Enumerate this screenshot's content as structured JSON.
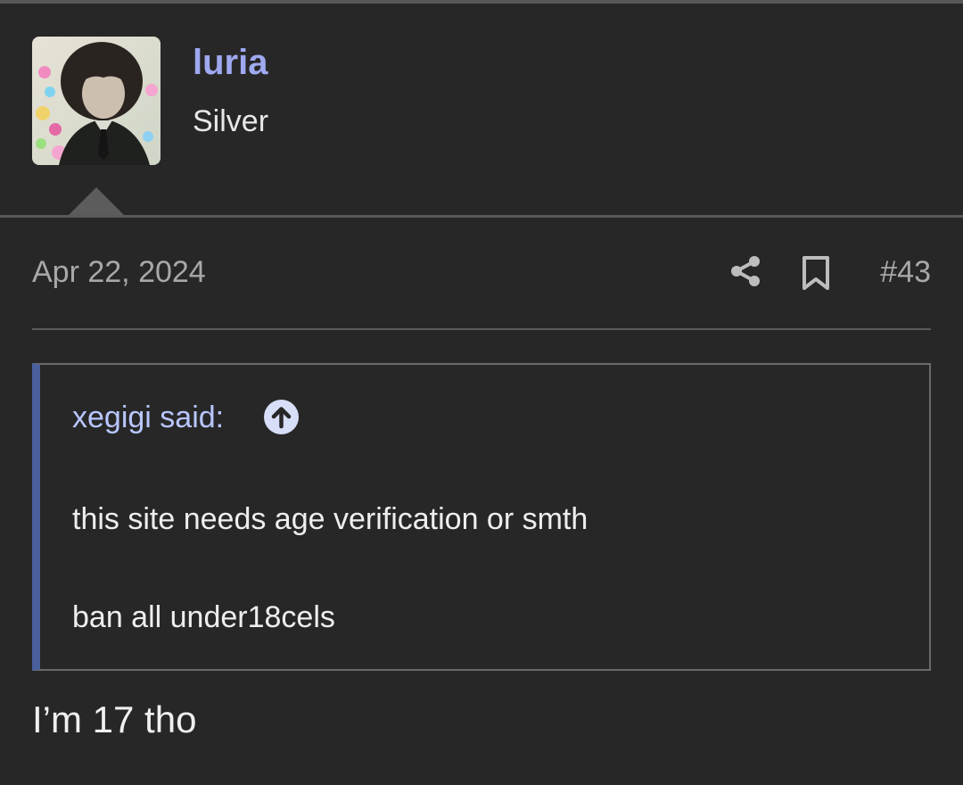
{
  "user": {
    "name": "luria",
    "title": "Silver",
    "avatar_icon": "avatar-image"
  },
  "post": {
    "date": "Apr 22, 2024",
    "number": "#43",
    "share_icon": "share-icon",
    "bookmark_icon": "bookmark-icon",
    "quote": {
      "author_text": "xegigi said:",
      "jump_icon": "arrow-up-circle-icon",
      "lines": [
        "this site needs age verification or smth",
        "ban all under18cels"
      ]
    },
    "body": "I’m 17 tho"
  },
  "colors": {
    "background": "#272727",
    "username": "#9ea9f0",
    "quote_author": "#b9c6ff",
    "quote_accent": "#4a5f9e",
    "muted": "#a8a8a8"
  }
}
